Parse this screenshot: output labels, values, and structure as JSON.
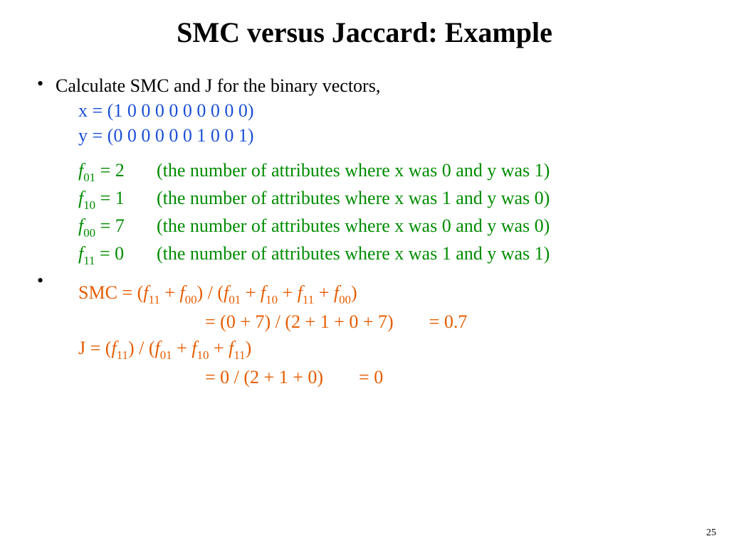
{
  "title": "SMC versus Jaccard: Example",
  "intro": "Calculate SMC and J for the binary vectors,",
  "vectors": {
    "x": "x = (1 0 0 0 0 0 0 0 0 0)",
    "y": "y = (0 0 0 0 0 0 1 0 0 1)"
  },
  "f": {
    "f01": {
      "sym_sub": "01",
      "eq": " = 2",
      "desc": "(the number of attributes where x was 0 and y was 1)"
    },
    "f10": {
      "sym_sub": "10",
      "eq": " = 1",
      "desc": "(the number of attributes where x was 1 and y was 0)"
    },
    "f00": {
      "sym_sub": "00",
      "eq": " = 7",
      "desc": "(the number of attributes where x was 0 and y was 0)"
    },
    "f11": {
      "sym_sub": "11",
      "eq": " = 0",
      "desc": "(the number of attributes where x was 1 and y was 1)"
    }
  },
  "smc": {
    "label": "SMC = (",
    "formula_mid1": " + ",
    "formula_close1": ") / (",
    "formula_close2": ")",
    "line2_mid": "= (0 + 7) / (2 + 1 + 0 + 7)",
    "line2_res": "= 0.7"
  },
  "j": {
    "label": "J = (",
    "formula_close1": ") / (",
    "formula_close2": ")",
    "line2_mid": "= 0 / (2 + 1 + 0)",
    "line2_res": "= 0"
  },
  "subs": {
    "s11": "11",
    "s00": "00",
    "s01": "01",
    "s10": "10"
  },
  "plus": " + ",
  "f_letter": "f",
  "page": "25"
}
